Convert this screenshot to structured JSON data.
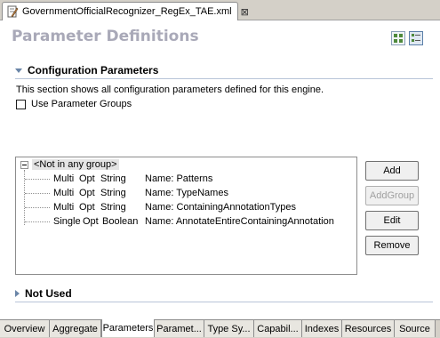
{
  "editor": {
    "tab_title": "GovernmentOfficialRecognizer_RegEx_TAE.xml",
    "close_glyph": "⊠"
  },
  "page_title": "Parameter Definitions",
  "config_section": {
    "title": "Configuration Parameters",
    "description": "This section shows all configuration parameters defined for this engine.",
    "use_groups_label": "Use Parameter Groups",
    "use_groups_checked": false
  },
  "tree": {
    "root_label": "<Not in any group>",
    "rows": [
      {
        "card": "Multi",
        "opt": "Opt",
        "type": "String",
        "name": "Name: Patterns"
      },
      {
        "card": "Multi",
        "opt": "Opt",
        "type": "String",
        "name": "Name: TypeNames"
      },
      {
        "card": "Multi",
        "opt": "Opt",
        "type": "String",
        "name": "Name: ContainingAnnotationTypes"
      },
      {
        "card": "Single",
        "opt": "Opt",
        "type": "Boolean",
        "name": "Name: AnnotateEntireContainingAnnotation"
      }
    ]
  },
  "buttons": {
    "add": "Add",
    "add_group": "AddGroup",
    "edit": "Edit",
    "remove": "Remove"
  },
  "not_used_section": {
    "title": "Not Used"
  },
  "bottom_tabs": [
    "Overview",
    "Aggregate",
    "Parameters",
    "Paramet...",
    "Type Sy...",
    "Capabil...",
    "Indexes",
    "Resources",
    "Source"
  ],
  "active_bottom_tab": "Parameters",
  "colors": {
    "title": "#a9a9b8",
    "section_rule": "#b8c4d8",
    "twisty": "#6b86a8"
  }
}
